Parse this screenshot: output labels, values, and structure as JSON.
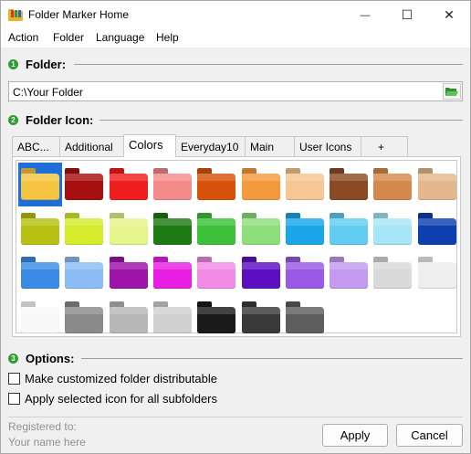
{
  "window": {
    "title": "Folder Marker Home",
    "minimize_glyph": "—",
    "maximize_glyph": "☐",
    "close_glyph": "✕"
  },
  "menu": [
    "Action",
    "Folder",
    "Language",
    "Help"
  ],
  "folder_section": {
    "number": "1",
    "label": "Folder:",
    "path": "C:\\Your Folder",
    "browse_icon": "open-folder-icon"
  },
  "icon_section": {
    "number": "2",
    "label": "Folder Icon:",
    "tabs": [
      "ABC...",
      "Additional",
      "Colors",
      "Everyday10",
      "Main",
      "User Icons",
      "+"
    ],
    "active_tab": "Colors",
    "folders": [
      {
        "name": "yellow",
        "color": "#f5c542",
        "selected": true
      },
      {
        "name": "dark-red",
        "color": "#a80f0f"
      },
      {
        "name": "red",
        "color": "#f01e1e"
      },
      {
        "name": "pink",
        "color": "#f58a8a"
      },
      {
        "name": "dark-orange",
        "color": "#d8520c"
      },
      {
        "name": "orange",
        "color": "#f59a3c"
      },
      {
        "name": "peach",
        "color": "#f7c692"
      },
      {
        "name": "brown",
        "color": "#8b4a24"
      },
      {
        "name": "light-brown",
        "color": "#d6894c"
      },
      {
        "name": "tan",
        "color": "#e4b88c"
      },
      {
        "name": "olive",
        "color": "#b8c112"
      },
      {
        "name": "lime",
        "color": "#d5ec2c"
      },
      {
        "name": "pale-lime",
        "color": "#e6f58e"
      },
      {
        "name": "dark-green",
        "color": "#1e7a12"
      },
      {
        "name": "green",
        "color": "#3ec03a"
      },
      {
        "name": "light-green",
        "color": "#8ede7c"
      },
      {
        "name": "sky-blue",
        "color": "#1aa7e8"
      },
      {
        "name": "light-sky-blue",
        "color": "#62ccf2"
      },
      {
        "name": "ice-blue",
        "color": "#a6e6f7"
      },
      {
        "name": "navy",
        "color": "#0e3fb0"
      },
      {
        "name": "blue",
        "color": "#3b8be6"
      },
      {
        "name": "light-blue",
        "color": "#8cbcf5"
      },
      {
        "name": "purple",
        "color": "#9c13a8"
      },
      {
        "name": "magenta",
        "color": "#e81ee4"
      },
      {
        "name": "light-magenta",
        "color": "#f28ae6"
      },
      {
        "name": "violet",
        "color": "#5c0fc2"
      },
      {
        "name": "light-violet",
        "color": "#9a5ae6"
      },
      {
        "name": "lavender",
        "color": "#c49af0"
      },
      {
        "name": "light-gray",
        "color": "#dadada"
      },
      {
        "name": "off-white",
        "color": "#eeeeee"
      },
      {
        "name": "white",
        "color": "#f9f9f9"
      },
      {
        "name": "gray",
        "color": "#8a8a8a"
      },
      {
        "name": "silver",
        "color": "#b8b8b8"
      },
      {
        "name": "pale-gray",
        "color": "#d0d0d0"
      },
      {
        "name": "black",
        "color": "#1a1a1a"
      },
      {
        "name": "dark-gray",
        "color": "#3a3a3a"
      },
      {
        "name": "charcoal",
        "color": "#5e5e5e"
      }
    ]
  },
  "options_section": {
    "number": "3",
    "label": "Options:",
    "checkboxes": [
      {
        "label": "Make customized folder distributable",
        "checked": false
      },
      {
        "label": "Apply selected icon for all subfolders",
        "checked": false
      }
    ]
  },
  "footer": {
    "registered_label": "Registered to:",
    "registered_name": "Your name here",
    "apply_label": "Apply",
    "cancel_label": "Cancel"
  }
}
